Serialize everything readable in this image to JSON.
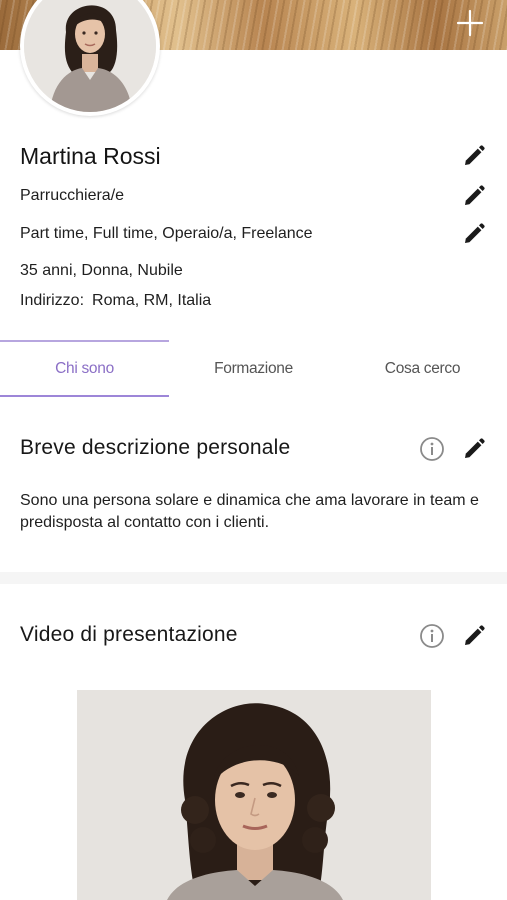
{
  "banner": {
    "add_icon": "plus-icon"
  },
  "profile": {
    "avatar_icon": "user-photo",
    "name": "Martina Rossi",
    "role": "Parrucchiera/e",
    "contract_types": "Part time, Full time, Operaio/a, Freelance",
    "personal": "35 anni, Donna, Nubile",
    "address_label": "Indirizzo:",
    "address_value": "Roma, RM, Italia",
    "edit_icon": "pencil-icon"
  },
  "tabs": [
    {
      "label": "Chi sono",
      "active": true
    },
    {
      "label": "Formazione",
      "active": false
    },
    {
      "label": "Cosa cerco",
      "active": false
    }
  ],
  "sections": {
    "description": {
      "title": "Breve descrizione personale",
      "text": "Sono una persona solare e dinamica che ama lavorare in team e predisposta al contatto con i clienti."
    },
    "video": {
      "title": "Video di presentazione"
    }
  },
  "colors": {
    "accent": "#8b6fc6",
    "accent_line": "#9d86d8",
    "icon": "#1a1a1a",
    "info_icon": "#8a8a8a",
    "divider": "#f5f5f5"
  }
}
